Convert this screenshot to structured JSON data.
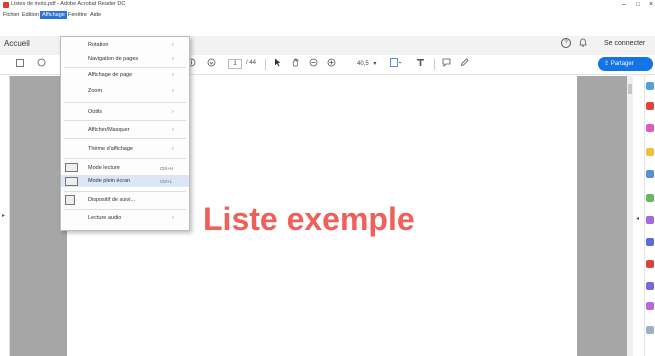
{
  "window": {
    "title": "Listes de mots.pdf - Adobe Acrobat Reader DC",
    "minimize": "–",
    "maximize": "□",
    "close": "×"
  },
  "menubar": {
    "items": [
      "Fichier",
      "Edition",
      "Affichage",
      "Fenêtre",
      "Aide"
    ]
  },
  "tabs": {
    "home": "Accueil",
    "help_icon": "?",
    "sign_in": "Se connecter"
  },
  "toolbar": {
    "page_current": "1",
    "page_total": "/ 44",
    "zoom": "40,5",
    "share_label": "Partager"
  },
  "view_menu": {
    "items": [
      {
        "label": "Rotation",
        "has_submenu": true
      },
      {
        "label": "Navigation de pages",
        "has_submenu": true
      },
      {
        "label": "Affichage de page",
        "has_submenu": true
      },
      {
        "label": "Zoom",
        "has_submenu": true
      },
      {
        "label": "Outils",
        "has_submenu": true
      },
      {
        "label": "Afficher/Masquer",
        "has_submenu": true
      },
      {
        "label": "Thème d'affichage",
        "has_submenu": true
      },
      {
        "label": "Mode lecture",
        "shortcut": "Ctrl+H"
      },
      {
        "label": "Mode plein écran",
        "shortcut": "Ctrl+L"
      },
      {
        "label": "Dispositif de suivi...",
        "has_submenu": false
      },
      {
        "label": "Lecture audio",
        "has_submenu": true
      }
    ],
    "submenu_arrow": "›"
  },
  "document": {
    "text": "Liste exemple",
    "text_color": "#f0605a"
  },
  "colors": {
    "accent": "#1473e6",
    "menu_active": "#2b73d6",
    "viewport": "#a6a6a6"
  }
}
